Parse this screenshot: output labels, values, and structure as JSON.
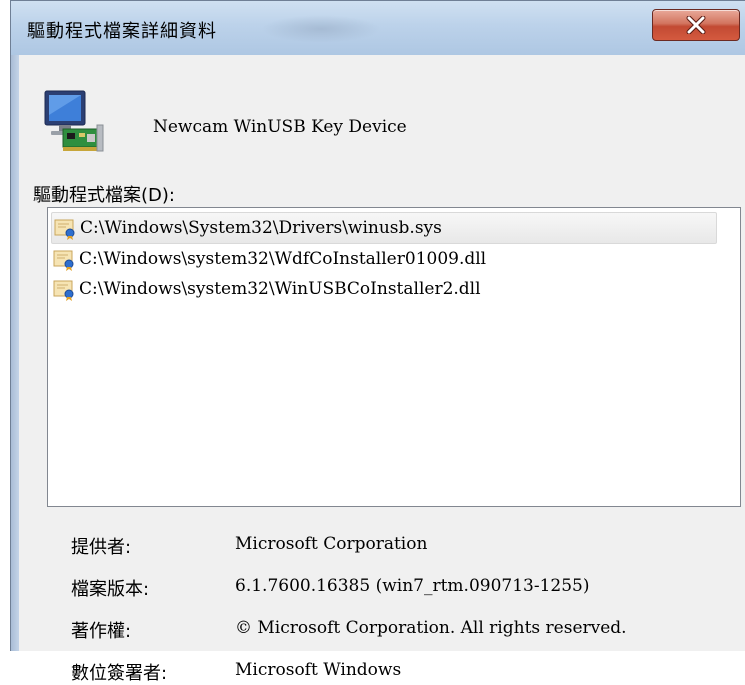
{
  "window": {
    "title": "驅動程式檔案詳細資料",
    "close_label": "X"
  },
  "device": {
    "name": "Newcam WinUSB Key Device",
    "icon": "computer-network-card-icon"
  },
  "files": {
    "label": "驅動程式檔案(D):",
    "items": [
      {
        "path": "C:\\Windows\\System32\\Drivers\\winusb.sys",
        "icon": "certificate-file-icon",
        "selected": true
      },
      {
        "path": "C:\\Windows\\system32\\WdfCoInstaller01009.dll",
        "icon": "certificate-file-icon",
        "selected": false
      },
      {
        "path": "C:\\Windows\\system32\\WinUSBCoInstaller2.dll",
        "icon": "certificate-file-icon",
        "selected": false
      }
    ]
  },
  "properties": {
    "provider_label": "提供者:",
    "provider_value": "Microsoft Corporation",
    "version_label": "檔案版本:",
    "version_value": "6.1.7600.16385 (win7_rtm.090713-1255)",
    "copyright_label": "著作權:",
    "copyright_value": "© Microsoft Corporation. All rights reserved.",
    "signer_label": "數位簽署者:",
    "signer_value": "Microsoft Windows"
  },
  "colors": {
    "titlebar": "#bcd2ea",
    "close_button": "#c24a33",
    "list_border": "#828790",
    "window_bg": "#f0f0f0"
  }
}
